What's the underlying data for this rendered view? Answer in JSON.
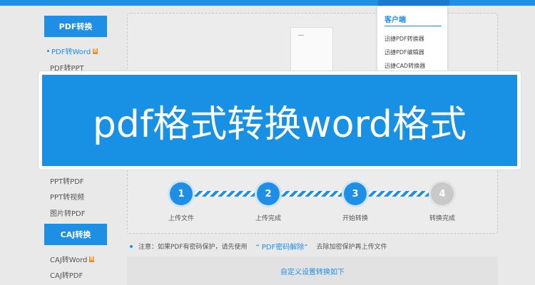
{
  "sidebar": {
    "groups": [
      {
        "header": "PDF转换"
      },
      {
        "header": "CAJ转换"
      }
    ],
    "items": [
      {
        "label": "PDF转Word",
        "badge": "新"
      },
      {
        "label": "PDF转PPT"
      },
      {
        "label": "PPT转PDF"
      },
      {
        "label": "PPT转视频"
      },
      {
        "label": "图片转PDF"
      },
      {
        "label": "CAJ转Word",
        "badge": "新"
      },
      {
        "label": "CAJ转PDF"
      }
    ]
  },
  "dropdown": {
    "title": "客户端",
    "items": [
      "迅捷PDF转换器",
      "迅捷PDF编辑器",
      "迅捷CAD转换器"
    ]
  },
  "banner": {
    "text": "pdf格式转换word格式"
  },
  "steps": [
    {
      "number": "1",
      "label": "上传文件",
      "active": true
    },
    {
      "number": "2",
      "label": "上传完成",
      "active": true
    },
    {
      "number": "3",
      "label": "开始转换",
      "active": true
    },
    {
      "number": "4",
      "label": "转换完成",
      "active": false
    }
  ],
  "notice": {
    "prefix": "注意：如果PDF有密码保护，请先使用",
    "link": "“ PDF密码解除”",
    "suffix": "去除加密保护再上传文件"
  },
  "custom_settings": {
    "label": "自定义设置转换如下"
  },
  "colors": {
    "accent": "#1f8fe6",
    "banner": "#1890e3",
    "step_inactive": "#c9c9c9"
  }
}
